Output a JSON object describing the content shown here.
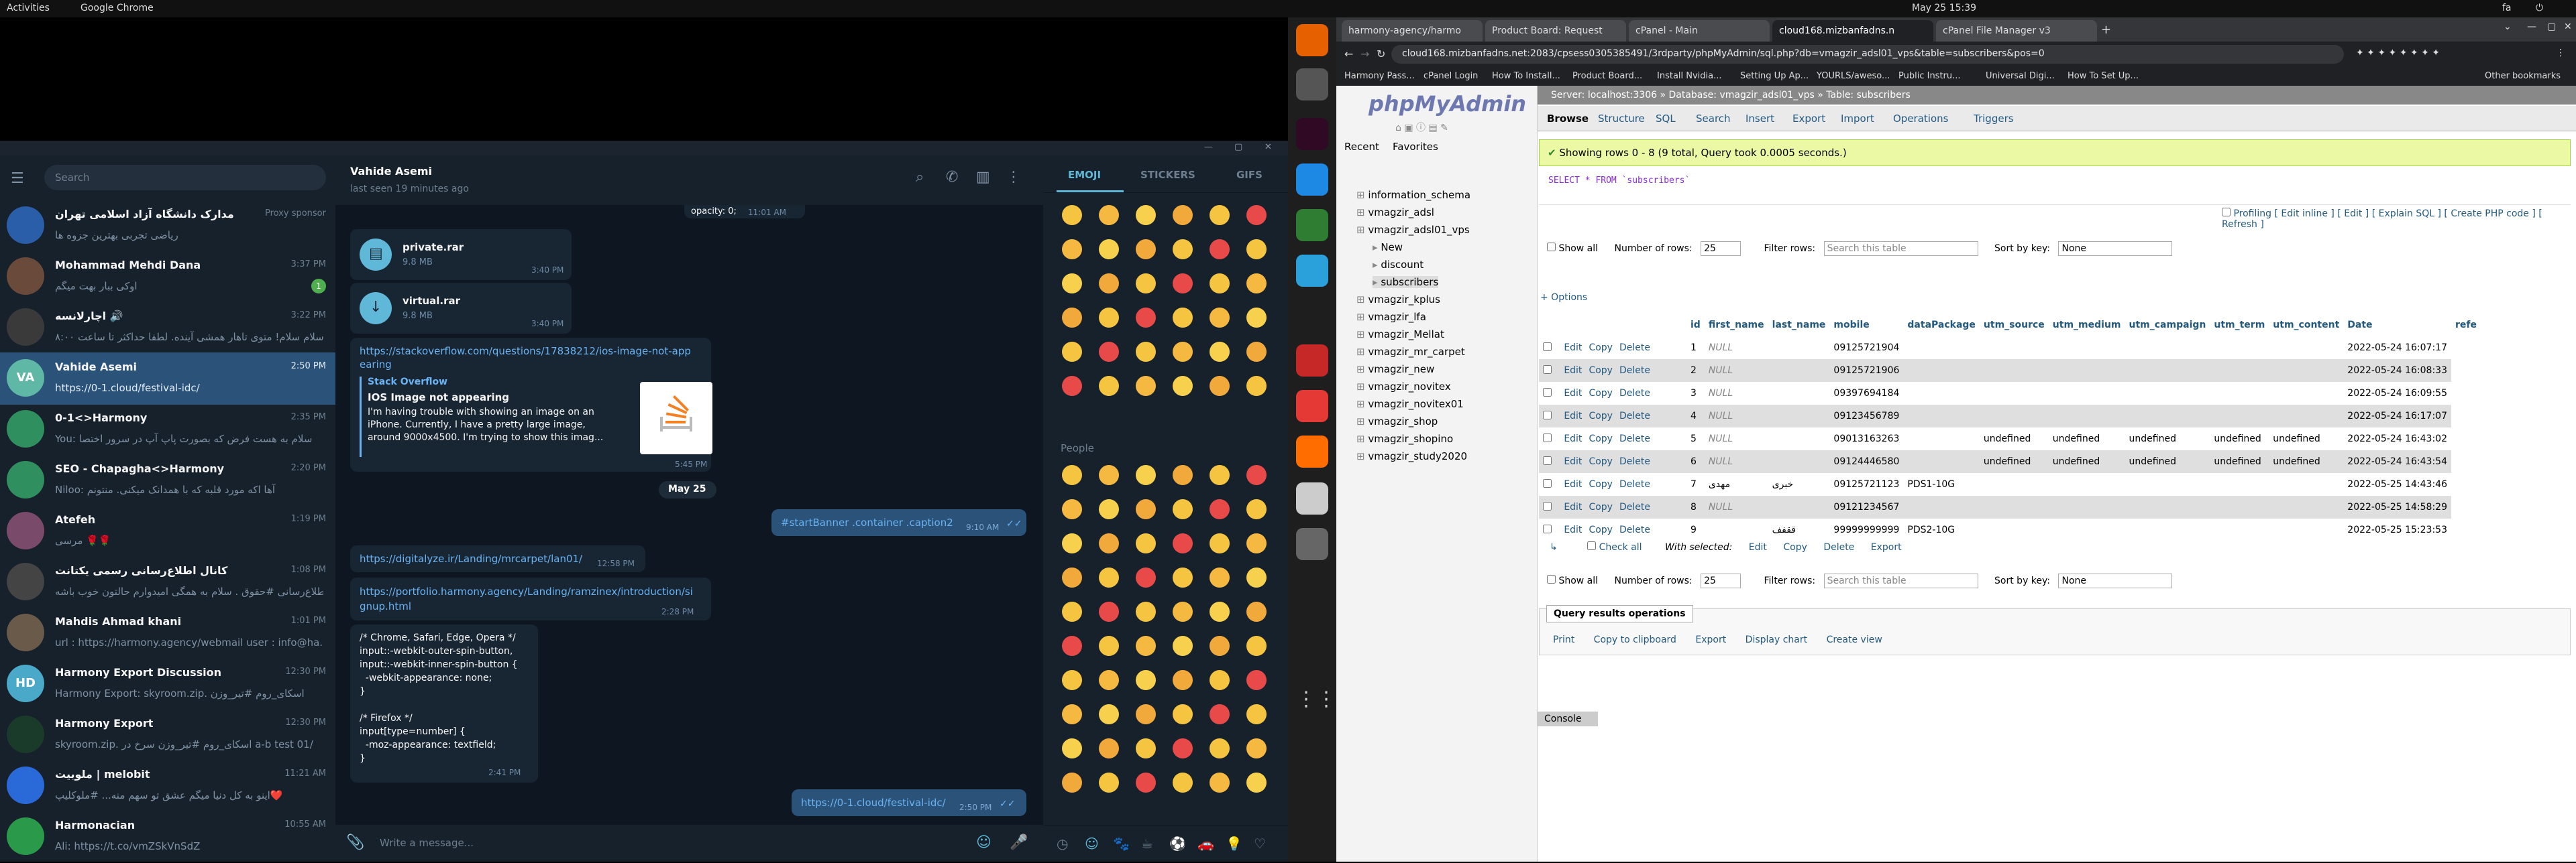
{
  "topbar": {
    "activities": "Activities",
    "app": "Google Chrome",
    "clock": "May 25  15:39",
    "lang": "fa"
  },
  "telegram": {
    "search_placeholder": "Search",
    "chats": [
      {
        "name": "مدارک دانشگاه آزاد اسلامی تهران",
        "time": "Proxy sponsor",
        "preview": "ریاضی تجربی بهترین جزوه ها",
        "color": "#2b5ea8"
      },
      {
        "name": "Mohammad Mehdi Dana",
        "time": "3:37 PM",
        "preview": "اوکی ببار بهت میگم",
        "badge": "1",
        "color": "#6a4a3a"
      },
      {
        "name": "اچارلانسه 🔊",
        "time": "3:22 PM",
        "preview": "سلام سلام! متوی تاهار همشی آینده. لطفا حداکثر تا ساعت ۸:۰۰",
        "color": "#3a3a3a"
      },
      {
        "name": "Vahide Asemi",
        "time": "2:50 PM",
        "preview": "https://0-1.cloud/festival-idc/",
        "initials": "VA",
        "color": "#5fb8a6"
      },
      {
        "name": "0-1<>Harmony",
        "time": "2:35 PM",
        "preview": "You: سلام به هست فرض که بصورت پاپ آپ در سرور اختصا",
        "color": "#2f8f5f"
      },
      {
        "name": "SEO - Chapagha<>Harmony",
        "time": "2:20 PM",
        "preview": "Niloo: آها اکه مورد قلبه که با همدانک میکنی. منتونم",
        "color": "#2f8f5f"
      },
      {
        "name": "Atefeh",
        "time": "1:19 PM",
        "preview": "مرسی 🌹🌹",
        "color": "#7a4a6a"
      },
      {
        "name": "کانال اطلاع‌رسانی رسمی یکتانت",
        "time": "1:08 PM",
        "preview": "اطلاع‌رسانی #حقوق . سلام به همگی امیدوارم حالتون خوب باشه",
        "color": "#444"
      },
      {
        "name": "Mahdis Ahmad khani",
        "time": "1:01 PM",
        "preview": "url : https://harmony.agency/webmail user : info@ha...",
        "color": "#6a5a4a"
      },
      {
        "name": "Harmony Export Discussion",
        "time": "12:30 PM",
        "preview": "Harmony Export: skyroom.zip. اسکای_روم #تیر_وزن",
        "initials": "HD",
        "color": "#4aa8c8"
      },
      {
        "name": "Harmony Export",
        "time": "12:30 PM",
        "preview": "skyroom.zip. اسکای_روم #تیر_وزن سرخ در a-b test 01/",
        "color": "#1a3a2a"
      },
      {
        "name": "ملوبیت | melobit",
        "time": "11:21 AM",
        "preview": "اینو به کل دنیا میگم عشق تو سهم منه... #ملوکلیپ❤️",
        "color": "#2a6ad8"
      },
      {
        "name": "Harmonacian",
        "time": "10:55 AM",
        "preview": "Ali: https://t.co/vmZSkVnSdZ",
        "color": "#2a9a4a"
      }
    ],
    "header": {
      "name": "Vahide Asemi",
      "status": "last seen 19 minutes ago"
    },
    "messages": {
      "top_partial": "opacity: 0;",
      "top_time": "11:01 AM",
      "file1_name": "private.rar",
      "file1_size": "9.8 MB",
      "file1_time": "3:40 PM",
      "file2_name": "virtual.rar",
      "file2_size": "9.8 MB",
      "file2_time": "3:40 PM",
      "so_link": "https://stackoverflow.com/questions/17838212/ios-image-not-appearing",
      "so_site": "Stack Overflow",
      "so_title": "IOS Image not appearing",
      "so_desc": "I'm having trouble with showing an image on an iPhone. Currently, I have a pretty large image, around 9000x4500. I'm trying to show this imag...",
      "so_time": "5:45 PM",
      "date_sep": "May 25",
      "out1": "#startBanner .container .caption2",
      "out1_time": "9:10 AM",
      "link1": "https://digitalyze.ir/Landing/mrcarpet/lan01/",
      "link1_time": "12:58 PM",
      "link2": "https://portfolio.harmony.agency/Landing/ramzinex/introduction/signup.html",
      "link2_time": "2:28 PM",
      "code": "/* Chrome, Safari, Edge, Opera */\ninput::-webkit-outer-spin-button,\ninput::-webkit-inner-spin-button {\n  -webkit-appearance: none;\n}\n\n/* Firefox */\ninput[type=number] {\n  -moz-appearance: textfield;\n}",
      "code_time": "2:41 PM",
      "out2": "https://0-1.cloud/festival-idc/",
      "out2_time": "2:50 PM"
    },
    "composer_placeholder": "Write a message...",
    "emoji_tabs": [
      "EMOJI",
      "STICKERS",
      "GIFS"
    ],
    "emoji_section": "People"
  },
  "browser": {
    "tabs": [
      "harmony-agency/harmo",
      "Product Board: Request",
      "cPanel - Main",
      "cloud168.mizbanfadns.n",
      "cPanel File Manager v3"
    ],
    "url": "cloud168.mizbanfadns.net:2083/cpsess0305385491/3rdparty/phpMyAdmin/sql.php?db=vmagzir_adsl01_vps&table=subscribers&pos=0",
    "bookmarks": [
      "Harmony Pass...",
      "cPanel Login",
      "How To Install...",
      "Product Board...",
      "Install Nvidia...",
      "Setting Up Ap...",
      "YOURLS/aweso...",
      "Public Instru...",
      "Universal Digi...",
      "How To Set Up...",
      "Other bookmarks"
    ]
  },
  "pma": {
    "logo": "phpMyAdmin",
    "recent": "Recent",
    "favorites": "Favorites",
    "breadcrumb": "Server: localhost:3306 » Database: vmagzir_adsl01_vps » Table: subscribers",
    "tree": [
      "information_schema",
      "vmagzir_adsl",
      "vmagzir_adsl01_vps",
      "New",
      "discount",
      "subscribers",
      "vmagzir_kplus",
      "vmagzir_lfa",
      "vmagzir_Mellat",
      "vmagzir_mr_carpet",
      "vmagzir_new",
      "vmagzir_novitex",
      "vmagzir_novitex01",
      "vmagzir_shop",
      "vmagzir_shopino",
      "vmagzir_study2020"
    ],
    "tabs": [
      "Browse",
      "Structure",
      "SQL",
      "Search",
      "Insert",
      "Export",
      "Import",
      "Operations",
      "Triggers"
    ],
    "success": "Showing rows 0 - 8 (9 total, Query took 0.0005 seconds.)",
    "sql": "SELECT * FROM `subscribers`",
    "profiling": "Profiling [ Edit inline ] [ Edit ] [ Explain SQL ] [ Create PHP code ] [ Refresh ]",
    "show_all": "Show all",
    "rows_label": "Number of rows:",
    "rows_val": "25",
    "filter_label": "Filter rows:",
    "filter_ph": "Search this table",
    "sort_label": "Sort by key:",
    "sort_val": "None",
    "options": "+ Options",
    "columns": [
      "id",
      "first_name",
      "last_name",
      "mobile",
      "dataPackage",
      "utm_source",
      "utm_medium",
      "utm_campaign",
      "utm_term",
      "utm_content",
      "Date",
      "refe"
    ],
    "rows": [
      [
        "1",
        "NULL",
        "",
        "09125721904",
        "",
        "",
        "",
        "",
        "",
        "",
        "2022-05-24 16:07:17"
      ],
      [
        "2",
        "NULL",
        "",
        "09125721906",
        "",
        "",
        "",
        "",
        "",
        "",
        "2022-05-24 16:08:33"
      ],
      [
        "3",
        "NULL",
        "",
        "09397694184",
        "",
        "",
        "",
        "",
        "",
        "",
        "2022-05-24 16:09:55"
      ],
      [
        "4",
        "NULL",
        "",
        "09123456789",
        "",
        "",
        "",
        "",
        "",
        "",
        "2022-05-24 16:17:07"
      ],
      [
        "5",
        "NULL",
        "",
        "09013163263",
        "",
        "undefined",
        "undefined",
        "undefined",
        "undefined",
        "undefined",
        "2022-05-24 16:43:02"
      ],
      [
        "6",
        "NULL",
        "",
        "09124446580",
        "",
        "undefined",
        "undefined",
        "undefined",
        "undefined",
        "undefined",
        "2022-05-24 16:43:54"
      ],
      [
        "7",
        "مهدی",
        "خبری",
        "09125721123",
        "PDS1-10G",
        "",
        "",
        "",
        "",
        "",
        "2022-05-25 14:43:46"
      ],
      [
        "8",
        "NULL",
        "",
        "09121234567",
        "",
        "",
        "",
        "",
        "",
        "",
        "2022-05-25 14:58:29"
      ],
      [
        "9",
        "",
        "ققفف",
        "99999999999",
        "PDS2-10G",
        "",
        "",
        "",
        "",
        "",
        "2022-05-25 15:23:53"
      ]
    ],
    "row_actions": [
      "Edit",
      "Copy",
      "Delete"
    ],
    "check_all": "Check all",
    "with_selected": "With selected:",
    "ws_edit": "Edit",
    "ws_copy": "Copy",
    "ws_delete": "Delete",
    "ws_export": "Export",
    "qro_title": "Query results operations",
    "qro": [
      "Print",
      "Copy to clipboard",
      "Export",
      "Display chart",
      "Create view"
    ],
    "console": "Console"
  }
}
